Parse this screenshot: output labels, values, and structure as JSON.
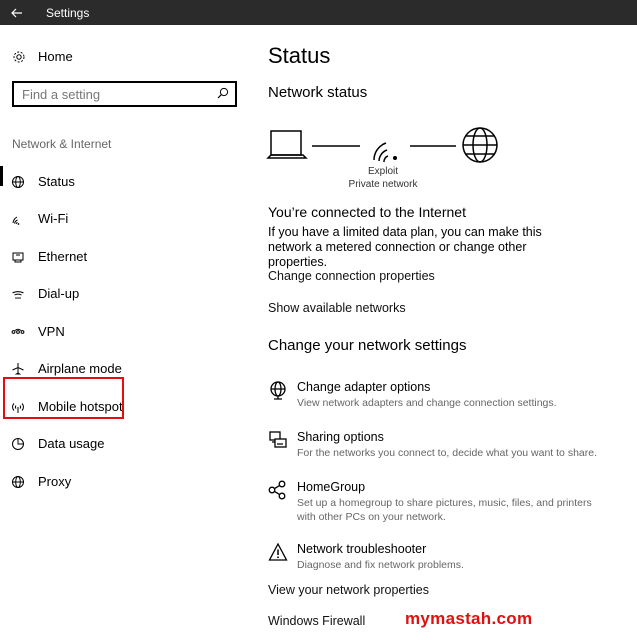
{
  "window": {
    "title": "Settings"
  },
  "sidebar": {
    "home_label": "Home",
    "search_placeholder": "Find a setting",
    "section_label": "Network & Internet",
    "items": [
      {
        "label": "Status",
        "icon": "globe-status-icon"
      },
      {
        "label": "Wi-Fi",
        "icon": "wifi-icon"
      },
      {
        "label": "Ethernet",
        "icon": "ethernet-icon"
      },
      {
        "label": "Dial-up",
        "icon": "dialup-icon"
      },
      {
        "label": "VPN",
        "icon": "vpn-icon"
      },
      {
        "label": "Airplane mode",
        "icon": "airplane-icon"
      },
      {
        "label": "Mobile hotspot",
        "icon": "hotspot-icon"
      },
      {
        "label": "Data usage",
        "icon": "data-usage-icon"
      },
      {
        "label": "Proxy",
        "icon": "globe-icon"
      }
    ],
    "active_item": "Status",
    "highlighted_item": "Mobile hotspot"
  },
  "main": {
    "title": "Status",
    "network_status_heading": "Network status",
    "network_name": "Exploit",
    "network_type": "Private network",
    "connected_title": "You’re connected to the Internet",
    "connected_desc": "If you have a limited data plan, you can make this network a metered connection or change other properties.",
    "link_change_props": "Change connection properties",
    "link_show_networks": "Show available networks",
    "change_heading": "Change your network settings",
    "options": [
      {
        "title": "Change adapter options",
        "desc": "View network adapters and change connection settings.",
        "icon": "adapter-globe-icon"
      },
      {
        "title": "Sharing options",
        "desc": "For the networks you connect to, decide what you want to share.",
        "icon": "sharing-icon"
      },
      {
        "title": "HomeGroup",
        "desc": "Set up a homegroup to share pictures, music, files, and printers with other PCs on your network.",
        "icon": "homegroup-icon"
      },
      {
        "title": "Network troubleshooter",
        "desc": "Diagnose and fix network problems.",
        "icon": "warning-icon"
      }
    ],
    "link_view_props": "View your network properties",
    "link_firewall": "Windows Firewall"
  },
  "watermark": "mymastah.com",
  "colors": {
    "titlebar": "#2b2b2b",
    "highlight": "#e01010",
    "watermark": "#e01010"
  }
}
